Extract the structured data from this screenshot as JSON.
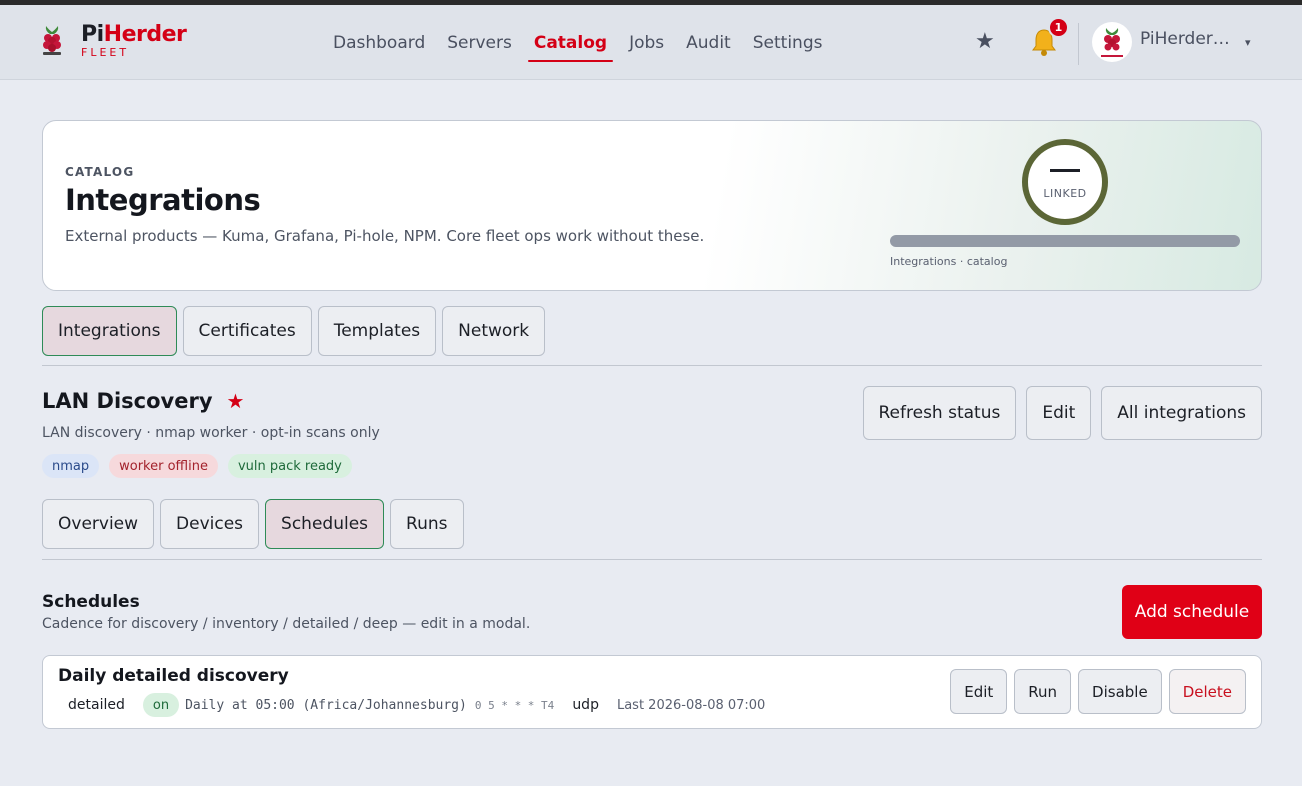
{
  "brand": {
    "name_pi": "Pi",
    "name_rest": "Herder",
    "sub": "FLEET"
  },
  "nav": {
    "items": [
      {
        "label": "Dashboard",
        "active": false
      },
      {
        "label": "Servers",
        "active": false
      },
      {
        "label": "Catalog",
        "active": true
      },
      {
        "label": "Jobs",
        "active": false
      },
      {
        "label": "Audit",
        "active": false
      },
      {
        "label": "Settings",
        "active": false
      }
    ]
  },
  "header": {
    "notification_count": "1",
    "user_name": "PiHerder Admin",
    "star_glyph": "★",
    "caret_glyph": "▾",
    "icons": [
      "star-icon",
      "bell-icon",
      "chevron-down-icon"
    ]
  },
  "hero": {
    "eyebrow": "CATALOG",
    "title": "Integrations",
    "description": "External products — Kuma, Grafana, Pi-hole, NPM. Core fleet ops work without these.",
    "ring_label": "LINKED",
    "progress": 0,
    "caption": "Integrations · catalog",
    "accent_color": "#5b6636"
  },
  "catalog_tabs": [
    {
      "label": "Integrations",
      "active": true
    },
    {
      "label": "Certificates",
      "active": false
    },
    {
      "label": "Templates",
      "active": false
    },
    {
      "label": "Network",
      "active": false
    }
  ],
  "detail": {
    "title": "LAN Discovery",
    "star": "★",
    "subtitle": "LAN discovery · nmap worker · opt-in scans only",
    "pills": [
      {
        "label": "nmap",
        "tone": "blue"
      },
      {
        "label": "worker offline",
        "tone": "red"
      },
      {
        "label": "vuln pack ready",
        "tone": "green"
      }
    ],
    "actions": {
      "refresh": "Refresh status",
      "edit": "Edit",
      "all": "All integrations"
    }
  },
  "detail_tabs": [
    {
      "label": "Overview",
      "active": false
    },
    {
      "label": "Devices",
      "active": false
    },
    {
      "label": "Schedules",
      "active": true
    },
    {
      "label": "Runs",
      "active": false
    }
  ],
  "schedules": {
    "title": "Schedules",
    "subtitle": "Cadence for discovery / inventory / detailed / deep — edit in a modal.",
    "add_label": "Add schedule",
    "rows": [
      {
        "name": "Daily detailed discovery",
        "kind": "detailed",
        "status": "on",
        "cadence": "Daily at 05:00 (Africa/Johannesburg)",
        "cron": "0 5 * * * T4",
        "protocol": "udp",
        "last": "Last 2026-08-08 07:00",
        "actions": {
          "edit": "Edit",
          "run": "Run",
          "disable": "Disable",
          "delete": "Delete"
        }
      }
    ]
  },
  "colors": {
    "brand": "#d40016",
    "primary_button": "#e00016",
    "active_border": "#2e8b57",
    "active_tab_bg": "#e6d8de"
  }
}
